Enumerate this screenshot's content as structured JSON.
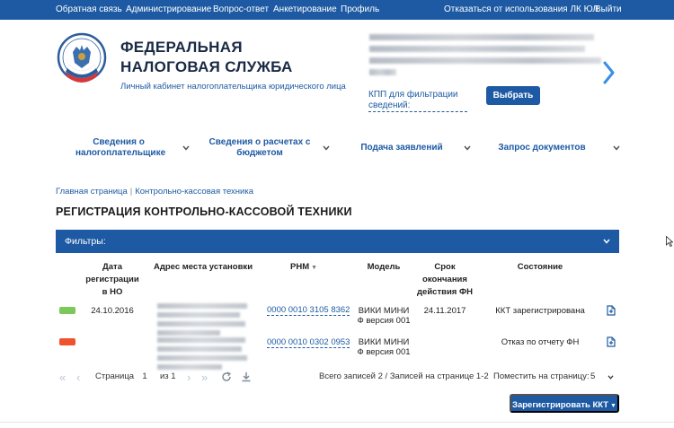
{
  "topbar": {
    "feedback": "Обратная связь",
    "admin": "Администрирование",
    "qa": "Вопрос-ответ",
    "survey": "Анкетирование",
    "profile": "Профиль",
    "decline": "Отказаться от использования ЛК ЮЛ",
    "logout": "Выйти"
  },
  "header": {
    "title_line1": "ФЕДЕРАЛЬНАЯ",
    "title_line2": "НАЛОГОВАЯ СЛУЖБА",
    "subtitle": "Личный кабинет налогоплательщика юридического лица",
    "kpp_line1": "КПП для фильтрации",
    "kpp_line2": "сведений:",
    "select_button": "Выбрать"
  },
  "nav": {
    "item1": "Сведения о налогоплательщике",
    "item2": "Сведения о расчетах с бюджетом",
    "item3": "Подача заявлений",
    "item4": "Запрос документов"
  },
  "breadcrumb": {
    "home": "Главная страница",
    "current": "Контрольно-кассовая техника"
  },
  "page_title": "РЕГИСТРАЦИЯ КОНТРОЛЬНО-КАССОВОЙ ТЕХНИКИ",
  "filters_label": "Фильтры:",
  "table": {
    "headers": {
      "reg_date": "Дата регистрации в НО",
      "address": "Адрес места установки",
      "rnm": "РНМ",
      "model": "Модель",
      "fn_expiry": "Срок окончания действия ФН",
      "state": "Состояние"
    },
    "rows": [
      {
        "status_color": "#7cc85a",
        "reg_date": "24.10.2016",
        "rnm": "0000 0010 3105 8362",
        "model": "ВИКИ МИНИ Ф версия 001",
        "fn_expiry": "24.11.2017",
        "state": "ККТ зарегистрирована"
      },
      {
        "status_color": "#f0522d",
        "reg_date": "",
        "rnm": "0000 0010 0302 0953",
        "model": "ВИКИ МИНИ Ф версия 001",
        "fn_expiry": "",
        "state": "Отказ по отчету ФН"
      }
    ]
  },
  "pagination": {
    "page_label": "Страница",
    "page_value": "1",
    "of_label": "из 1",
    "summary": "Всего записей 2 / Записей на странице 1-2",
    "page_size_label": "Поместить на страницу:",
    "page_size_value": "5"
  },
  "register_button": "Зарегистрировать ККТ",
  "colors": {
    "brand_blue": "#1d5aa3",
    "status_green": "#7cc85a",
    "status_red": "#f0522d"
  }
}
